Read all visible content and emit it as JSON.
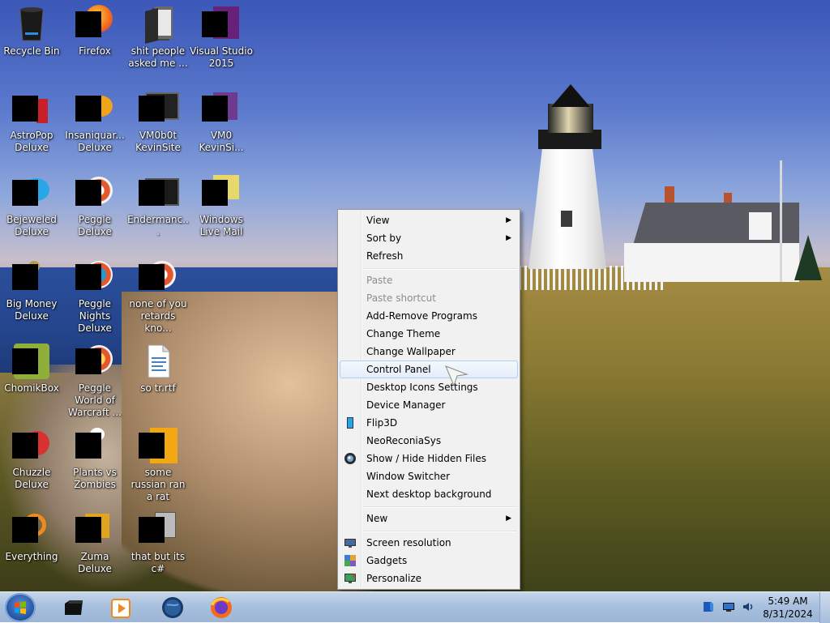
{
  "desktop": {
    "icons": [
      {
        "label": "Recycle Bin"
      },
      {
        "label": "Firefox"
      },
      {
        "label": "shit people asked me ..."
      },
      {
        "label": "Visual Studio 2015"
      },
      {
        "label": "AstroPop Deluxe"
      },
      {
        "label": "Insaniquar... Deluxe"
      },
      {
        "label": "VM0b0t KevinSite"
      },
      {
        "label": "VM0 KevinSi..."
      },
      {
        "label": "Bejeweled Deluxe"
      },
      {
        "label": "Peggle Deluxe"
      },
      {
        "label": "Endermanc..."
      },
      {
        "label": "Windows Live Mail"
      },
      {
        "label": "Big Money Deluxe"
      },
      {
        "label": "Peggle Nights Deluxe"
      },
      {
        "label": "none of you retards kno..."
      },
      {
        "label": "ChomikBox"
      },
      {
        "label": "Peggle World of Warcraft ..."
      },
      {
        "label": "so tr.rtf"
      },
      {
        "label": "Chuzzle Deluxe"
      },
      {
        "label": "Plants vs Zombies"
      },
      {
        "label": "some russian ran a rat"
      },
      {
        "label": "Everything"
      },
      {
        "label": "Zuma Deluxe"
      },
      {
        "label": "that but its c#"
      }
    ]
  },
  "context_menu": {
    "view": "View",
    "sort_by": "Sort by",
    "refresh": "Refresh",
    "paste": "Paste",
    "paste_shortcut": "Paste shortcut",
    "add_remove_programs": "Add-Remove Programs",
    "change_theme": "Change Theme",
    "change_wallpaper": "Change Wallpaper",
    "control_panel": "Control Panel",
    "desktop_icons_settings": "Desktop Icons Settings",
    "device_manager": "Device Manager",
    "flip3d": "Flip3D",
    "neoreconiasys": "NeoReconiaSys",
    "show_hide_hidden_files": "Show / Hide Hidden Files",
    "window_switcher": "Window Switcher",
    "next_desktop_background": "Next desktop background",
    "new": "New",
    "screen_resolution": "Screen resolution",
    "gadgets": "Gadgets",
    "personalize": "Personalize",
    "highlighted_item": "Control Panel"
  },
  "taskbar": {
    "pinned": [
      {
        "icon": "terminal-icon"
      },
      {
        "icon": "media-player-icon"
      },
      {
        "icon": "globe-icon"
      },
      {
        "icon": "firefox-icon"
      }
    ],
    "tray": {
      "icons": [
        "action-center-icon",
        "network-icon",
        "volume-icon"
      ]
    },
    "clock": {
      "time": "5:49 AM",
      "date": "8/31/2024"
    }
  },
  "colors": {
    "menu_bg": "#f1f1f1",
    "menu_highlight": "#e3edf9",
    "menu_highlight_border": "#aecff7",
    "disabled_text": "#8d8d8d",
    "taskbar": "#a9c0de"
  }
}
